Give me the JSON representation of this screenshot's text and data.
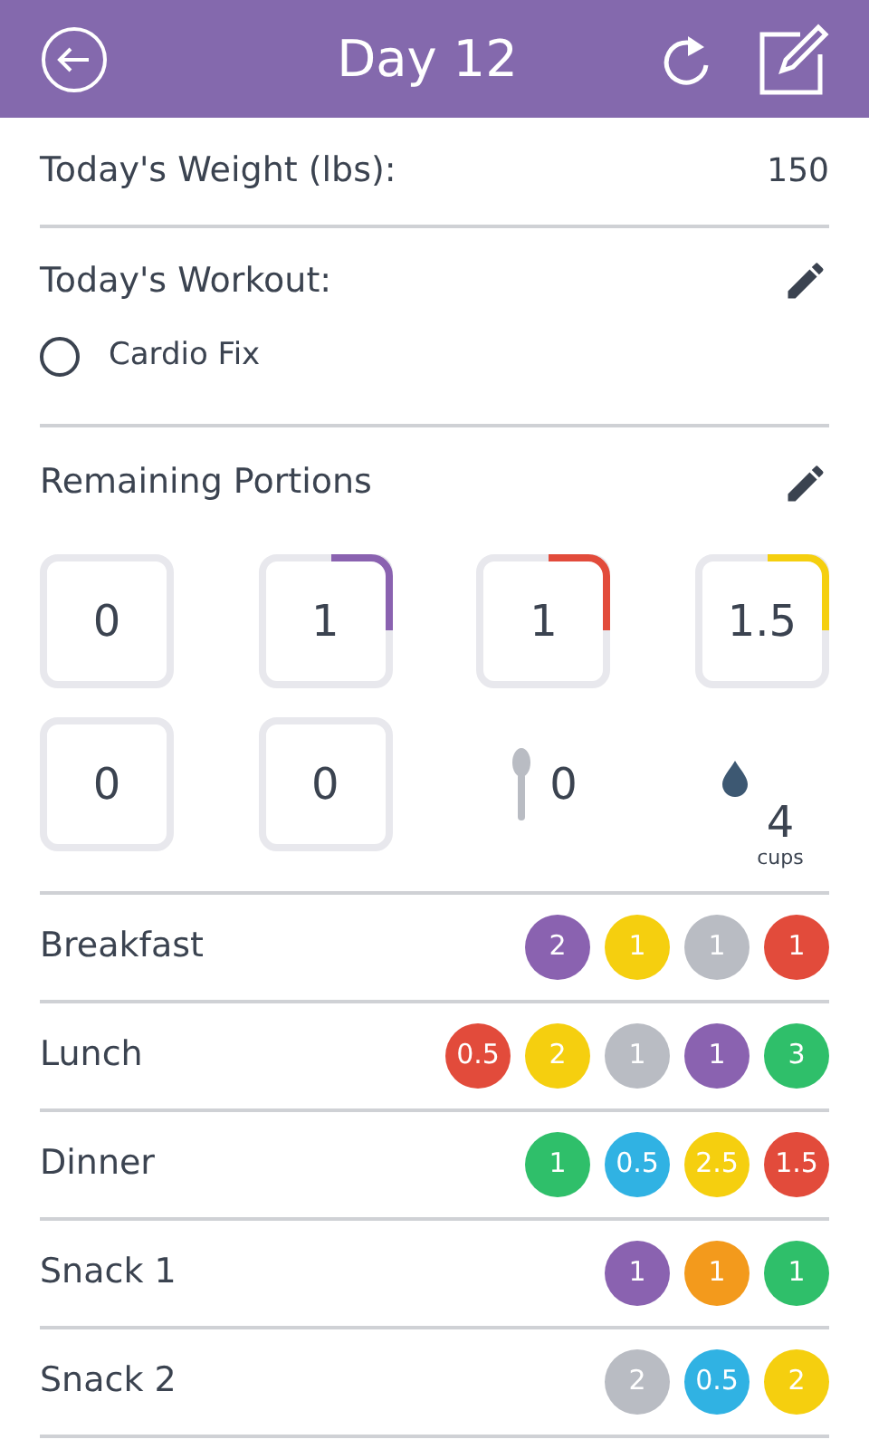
{
  "header": {
    "title": "Day 12"
  },
  "weight": {
    "label": "Today's Weight (lbs):",
    "value": "150"
  },
  "workout": {
    "label": "Today's Workout:",
    "items": [
      {
        "label": "Cardio Fix",
        "checked": false
      }
    ]
  },
  "portions": {
    "label": "Remaining Portions",
    "items": [
      {
        "kind": "box",
        "value": "0"
      },
      {
        "kind": "box",
        "value": "1",
        "color": "#8a62b0"
      },
      {
        "kind": "box",
        "value": "1",
        "color": "#e24b3b"
      },
      {
        "kind": "box",
        "value": "1.5",
        "color": "#f5cf0f"
      },
      {
        "kind": "box",
        "value": "0"
      },
      {
        "kind": "box",
        "value": "0"
      },
      {
        "kind": "spoon",
        "value": "0"
      },
      {
        "kind": "water",
        "value": "4",
        "unit": "cups"
      }
    ]
  },
  "meals": [
    {
      "name": "Breakfast",
      "portions": [
        {
          "value": "2",
          "color": "#8a62b0"
        },
        {
          "value": "1",
          "color": "#f5cf0f"
        },
        {
          "value": "1",
          "color": "#b9bcc3"
        },
        {
          "value": "1",
          "color": "#e24b3b"
        }
      ]
    },
    {
      "name": "Lunch",
      "portions": [
        {
          "value": "0.5",
          "color": "#e24b3b"
        },
        {
          "value": "2",
          "color": "#f5cf0f"
        },
        {
          "value": "1",
          "color": "#b9bcc3"
        },
        {
          "value": "1",
          "color": "#8a62b0"
        },
        {
          "value": "3",
          "color": "#2fbf6a"
        }
      ]
    },
    {
      "name": "Dinner",
      "portions": [
        {
          "value": "1",
          "color": "#2fbf6a"
        },
        {
          "value": "0.5",
          "color": "#30b2e3"
        },
        {
          "value": "2.5",
          "color": "#f5cf0f"
        },
        {
          "value": "1.5",
          "color": "#e24b3b"
        }
      ]
    },
    {
      "name": "Snack 1",
      "portions": [
        {
          "value": "1",
          "color": "#8a62b0"
        },
        {
          "value": "1",
          "color": "#f39a1c"
        },
        {
          "value": "1",
          "color": "#2fbf6a"
        }
      ]
    },
    {
      "name": "Snack 2",
      "portions": [
        {
          "value": "2",
          "color": "#b9bcc3"
        },
        {
          "value": "0.5",
          "color": "#30b2e3"
        },
        {
          "value": "2",
          "color": "#f5cf0f"
        }
      ]
    }
  ]
}
